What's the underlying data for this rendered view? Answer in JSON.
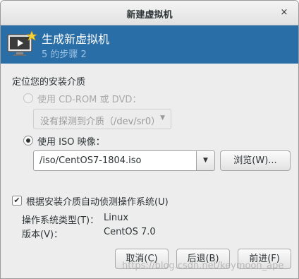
{
  "window": {
    "title": "新建虚拟机",
    "close_glyph": "×"
  },
  "header": {
    "title": "生成新虚拟机",
    "step": "5 的步骤 2",
    "icon": "monitor-new-icon"
  },
  "install_media": {
    "section_label": "定位您的安装介质",
    "cdrom_radio_label": "使用  CD-ROM 或 DVD：",
    "cdrom_radio_selected": false,
    "cdrom_radio_enabled": false,
    "cdrom_combo_value": "没有探测到介质（/dev/sr0）",
    "iso_radio_label": "使用  ISO 映像：",
    "iso_radio_selected": true,
    "iso_path_value": "/iso/CentOS7-1804.iso",
    "browse_button_label": "浏览(W)..."
  },
  "os_detection": {
    "auto_detect_label": "根据安装介质自动侦测操作系统(U)",
    "auto_detect_checked": true,
    "os_type_label": "操作系统类型(T)：",
    "os_type_value": "Linux",
    "version_label": "版本(V)：",
    "version_value": "CentOS 7.0"
  },
  "buttons": {
    "cancel": "取消(C)",
    "back": "后退(B)",
    "forward": "前进(F)"
  },
  "watermark": "https://blog.csdn.net/keymoon_ape",
  "colors": {
    "header_bg": "#2a6ea8",
    "header_step": "#9cc3e4",
    "window_bg": "#ededed"
  }
}
